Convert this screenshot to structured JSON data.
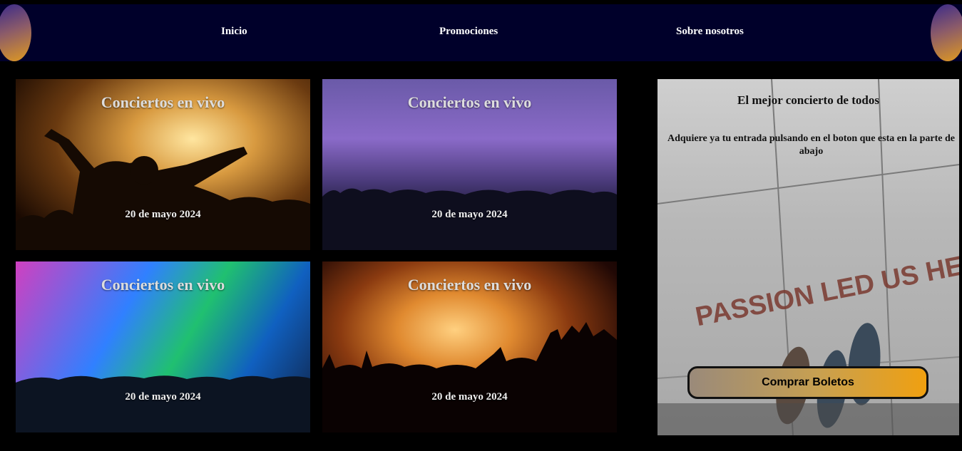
{
  "nav": {
    "items": [
      {
        "label": "Inicio"
      },
      {
        "label": "Promociones"
      },
      {
        "label": "Sobre nosotros"
      }
    ]
  },
  "cards": [
    {
      "title": "Conciertos en vivo",
      "date": "20 de mayo 2024"
    },
    {
      "title": "Conciertos en vivo",
      "date": "20 de mayo 2024"
    },
    {
      "title": "Conciertos en vivo",
      "date": "20 de mayo 2024"
    },
    {
      "title": "Conciertos en vivo",
      "date": "20 de mayo 2024"
    }
  ],
  "promo": {
    "title": "El mejor concierto de todos",
    "text": "Adquiere ya tu entrada pulsando en el boton que esta en la parte de abajo",
    "image_text": "PASSION LED US HERE",
    "button_label": "Comprar Boletos"
  },
  "colors": {
    "nav_bg": "#00002a",
    "page_bg": "#000000",
    "button_gradient_end": "#f0a010"
  }
}
